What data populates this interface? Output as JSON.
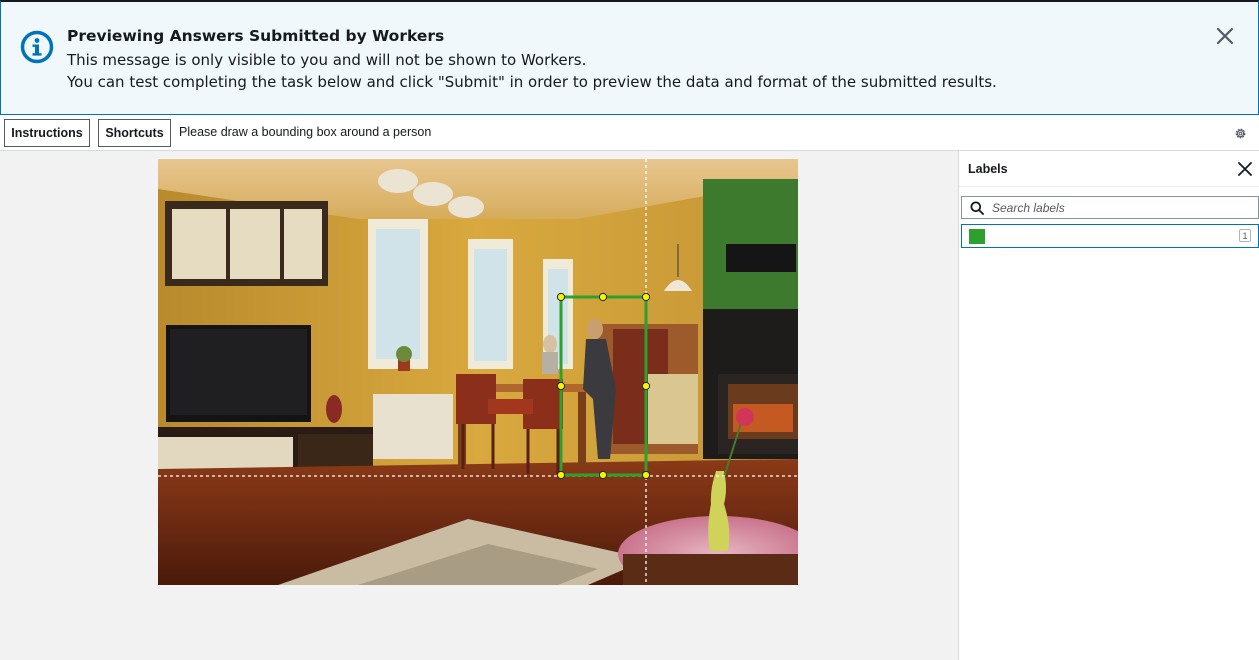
{
  "banner": {
    "title": "Previewing Answers Submitted by Workers",
    "line1": "This message is only visible to you and will not be shown to Workers.",
    "line2": "You can test completing the task below and click \"Submit\" in order to preview the data and format of the submitted results.",
    "icon": "info-icon",
    "close_icon": "close-icon"
  },
  "toolbar": {
    "instructions_label": "Instructions",
    "shortcuts_label": "Shortcuts",
    "prompt": "Please draw a bounding box around a person",
    "settings_icon": "gear-icon"
  },
  "labels_panel": {
    "title": "Labels",
    "search_placeholder": "Search labels",
    "items": [
      {
        "name": "",
        "color": "#2ea02e",
        "count": "1"
      }
    ]
  },
  "colors": {
    "info_blue": "#0073bb",
    "box_green": "#2ea02e",
    "handle_yellow": "#f5f500"
  }
}
